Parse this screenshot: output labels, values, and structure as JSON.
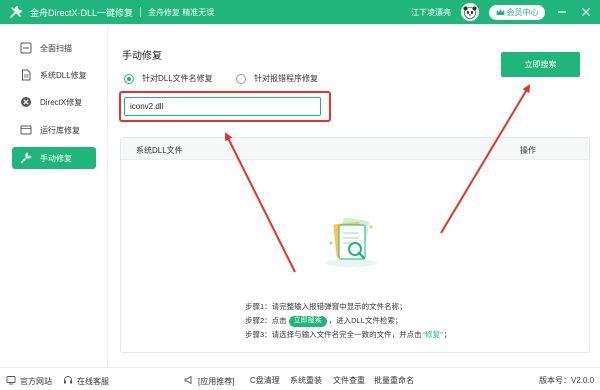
{
  "titlebar": {
    "app_title": "金舟DirectX·DLL一键修复",
    "slogan": "金舟修复 精准无误",
    "user_name": "江下凌漂亮",
    "vip_label": "会员中心",
    "brand_color": "#21b57e"
  },
  "sidebar": {
    "items": [
      {
        "label": "全面扫描",
        "icon": "scan-icon",
        "active": false
      },
      {
        "label": "系统DLL修复",
        "icon": "dll-icon",
        "active": false
      },
      {
        "label": "DirectX修复",
        "icon": "directx-icon",
        "active": false
      },
      {
        "label": "运行库修复",
        "icon": "runtime-icon",
        "active": false
      },
      {
        "label": "手动修复",
        "icon": "wrench-icon",
        "active": true
      }
    ]
  },
  "main": {
    "title": "手动修复",
    "radio_options": [
      {
        "label": "针对DLL文件名修复",
        "checked": true
      },
      {
        "label": "针对报错程序修复",
        "checked": false
      }
    ],
    "search_button": "立即搜索",
    "input_value": "iconv2.dll",
    "table_headers": {
      "dll_file": "系统DLL文件",
      "operation": "操作"
    },
    "steps": {
      "step1": "步骤1：请完整输入报错弹窗中显示的文件名称；",
      "step2_prefix": "步骤2：点击",
      "step2_button": "立即搜索",
      "step2_suffix": "，进入DLL文件检索；",
      "step3_prefix": "步骤3：请选择与输入文件名完全一致的文件，并点击",
      "step3_highlight": "“修复”",
      "step3_suffix": "；"
    },
    "highlight_color": "#e0342c"
  },
  "footer": {
    "website": "官方网站",
    "support": "在线客服",
    "recommend": "[应用推荐]",
    "links": [
      "C盘清理",
      "系统重装",
      "文件查重",
      "批量重命名"
    ],
    "version": "版本号：V2.0.0"
  }
}
